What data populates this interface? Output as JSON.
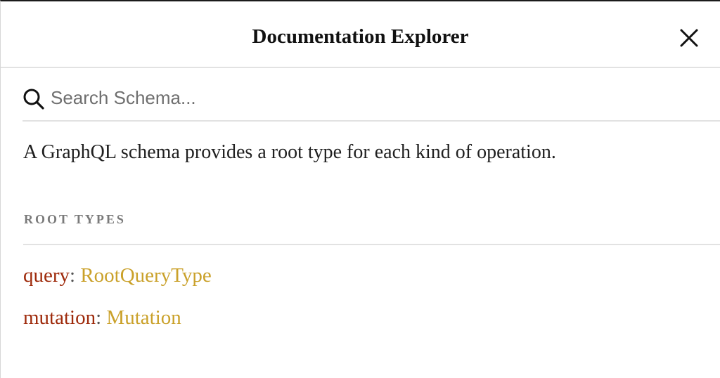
{
  "header": {
    "title": "Documentation Explorer",
    "close_icon": "close-icon"
  },
  "search": {
    "icon": "search-icon",
    "placeholder": "Search Schema...",
    "value": ""
  },
  "description": "A GraphQL schema provides a root type for each kind of operation.",
  "root_types": {
    "section_title": "ROOT TYPES",
    "items": [
      {
        "field": "query",
        "separator": ": ",
        "type": "RootQueryType"
      },
      {
        "field": "mutation",
        "separator": ": ",
        "type": "Mutation"
      }
    ]
  },
  "colors": {
    "field_name": "#9e2a0b",
    "type_name": "#caa12a",
    "section_title": "#7a7a7a"
  }
}
